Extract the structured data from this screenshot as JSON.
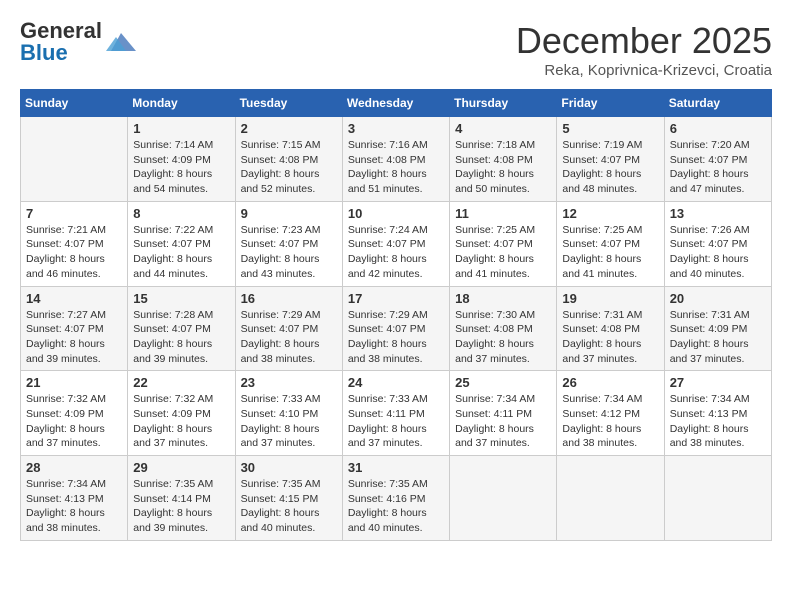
{
  "header": {
    "logo_general": "General",
    "logo_blue": "Blue",
    "month": "December 2025",
    "location": "Reka, Koprivnica-Krizevci, Croatia"
  },
  "days_of_week": [
    "Sunday",
    "Monday",
    "Tuesday",
    "Wednesday",
    "Thursday",
    "Friday",
    "Saturday"
  ],
  "weeks": [
    [
      {
        "day": "",
        "info": ""
      },
      {
        "day": "1",
        "info": "Sunrise: 7:14 AM\nSunset: 4:09 PM\nDaylight: 8 hours\nand 54 minutes."
      },
      {
        "day": "2",
        "info": "Sunrise: 7:15 AM\nSunset: 4:08 PM\nDaylight: 8 hours\nand 52 minutes."
      },
      {
        "day": "3",
        "info": "Sunrise: 7:16 AM\nSunset: 4:08 PM\nDaylight: 8 hours\nand 51 minutes."
      },
      {
        "day": "4",
        "info": "Sunrise: 7:18 AM\nSunset: 4:08 PM\nDaylight: 8 hours\nand 50 minutes."
      },
      {
        "day": "5",
        "info": "Sunrise: 7:19 AM\nSunset: 4:07 PM\nDaylight: 8 hours\nand 48 minutes."
      },
      {
        "day": "6",
        "info": "Sunrise: 7:20 AM\nSunset: 4:07 PM\nDaylight: 8 hours\nand 47 minutes."
      }
    ],
    [
      {
        "day": "7",
        "info": "Sunrise: 7:21 AM\nSunset: 4:07 PM\nDaylight: 8 hours\nand 46 minutes."
      },
      {
        "day": "8",
        "info": "Sunrise: 7:22 AM\nSunset: 4:07 PM\nDaylight: 8 hours\nand 44 minutes."
      },
      {
        "day": "9",
        "info": "Sunrise: 7:23 AM\nSunset: 4:07 PM\nDaylight: 8 hours\nand 43 minutes."
      },
      {
        "day": "10",
        "info": "Sunrise: 7:24 AM\nSunset: 4:07 PM\nDaylight: 8 hours\nand 42 minutes."
      },
      {
        "day": "11",
        "info": "Sunrise: 7:25 AM\nSunset: 4:07 PM\nDaylight: 8 hours\nand 41 minutes."
      },
      {
        "day": "12",
        "info": "Sunrise: 7:25 AM\nSunset: 4:07 PM\nDaylight: 8 hours\nand 41 minutes."
      },
      {
        "day": "13",
        "info": "Sunrise: 7:26 AM\nSunset: 4:07 PM\nDaylight: 8 hours\nand 40 minutes."
      }
    ],
    [
      {
        "day": "14",
        "info": "Sunrise: 7:27 AM\nSunset: 4:07 PM\nDaylight: 8 hours\nand 39 minutes."
      },
      {
        "day": "15",
        "info": "Sunrise: 7:28 AM\nSunset: 4:07 PM\nDaylight: 8 hours\nand 39 minutes."
      },
      {
        "day": "16",
        "info": "Sunrise: 7:29 AM\nSunset: 4:07 PM\nDaylight: 8 hours\nand 38 minutes."
      },
      {
        "day": "17",
        "info": "Sunrise: 7:29 AM\nSunset: 4:07 PM\nDaylight: 8 hours\nand 38 minutes."
      },
      {
        "day": "18",
        "info": "Sunrise: 7:30 AM\nSunset: 4:08 PM\nDaylight: 8 hours\nand 37 minutes."
      },
      {
        "day": "19",
        "info": "Sunrise: 7:31 AM\nSunset: 4:08 PM\nDaylight: 8 hours\nand 37 minutes."
      },
      {
        "day": "20",
        "info": "Sunrise: 7:31 AM\nSunset: 4:09 PM\nDaylight: 8 hours\nand 37 minutes."
      }
    ],
    [
      {
        "day": "21",
        "info": "Sunrise: 7:32 AM\nSunset: 4:09 PM\nDaylight: 8 hours\nand 37 minutes."
      },
      {
        "day": "22",
        "info": "Sunrise: 7:32 AM\nSunset: 4:09 PM\nDaylight: 8 hours\nand 37 minutes."
      },
      {
        "day": "23",
        "info": "Sunrise: 7:33 AM\nSunset: 4:10 PM\nDaylight: 8 hours\nand 37 minutes."
      },
      {
        "day": "24",
        "info": "Sunrise: 7:33 AM\nSunset: 4:11 PM\nDaylight: 8 hours\nand 37 minutes."
      },
      {
        "day": "25",
        "info": "Sunrise: 7:34 AM\nSunset: 4:11 PM\nDaylight: 8 hours\nand 37 minutes."
      },
      {
        "day": "26",
        "info": "Sunrise: 7:34 AM\nSunset: 4:12 PM\nDaylight: 8 hours\nand 38 minutes."
      },
      {
        "day": "27",
        "info": "Sunrise: 7:34 AM\nSunset: 4:13 PM\nDaylight: 8 hours\nand 38 minutes."
      }
    ],
    [
      {
        "day": "28",
        "info": "Sunrise: 7:34 AM\nSunset: 4:13 PM\nDaylight: 8 hours\nand 38 minutes."
      },
      {
        "day": "29",
        "info": "Sunrise: 7:35 AM\nSunset: 4:14 PM\nDaylight: 8 hours\nand 39 minutes."
      },
      {
        "day": "30",
        "info": "Sunrise: 7:35 AM\nSunset: 4:15 PM\nDaylight: 8 hours\nand 40 minutes."
      },
      {
        "day": "31",
        "info": "Sunrise: 7:35 AM\nSunset: 4:16 PM\nDaylight: 8 hours\nand 40 minutes."
      },
      {
        "day": "",
        "info": ""
      },
      {
        "day": "",
        "info": ""
      },
      {
        "day": "",
        "info": ""
      }
    ]
  ]
}
